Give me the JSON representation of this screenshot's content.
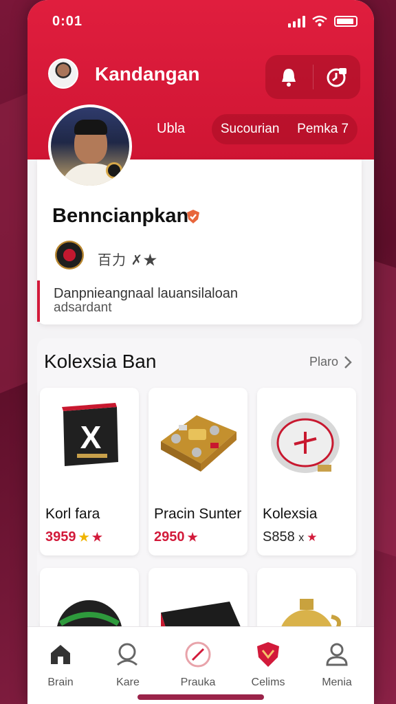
{
  "status": {
    "time": "0:01"
  },
  "header": {
    "app_title": "Kandangan",
    "tab_left": "Ubla",
    "tab_pill_a": "Sucourian",
    "tab_pill_b": "Pemka 7"
  },
  "profile": {
    "name": "Benncianpkan",
    "club_text": "百力 ✗★",
    "desc_line1": "Danpnieangnaal lauansilaloan",
    "desc_line2": "adsardant"
  },
  "collection": {
    "title": "Kolexsia Ban",
    "more_label": "Plaro",
    "items": [
      {
        "name": "Korl fara",
        "price": "3959",
        "stars": [
          "gold",
          "red"
        ]
      },
      {
        "name": "Pracin Sunter",
        "price": "2950",
        "stars": [
          "red"
        ]
      },
      {
        "name": "Kolexsia",
        "price": "S858",
        "extra": "x",
        "stars": [
          "red"
        ]
      }
    ]
  },
  "nav": {
    "items": [
      {
        "label": "Brain",
        "icon": "home-icon"
      },
      {
        "label": "Kare",
        "icon": "search-icon"
      },
      {
        "label": "Prauka",
        "icon": "slash-circle-icon"
      },
      {
        "label": "Celims",
        "icon": "shield-icon"
      },
      {
        "label": "Menia",
        "icon": "user-icon"
      }
    ]
  },
  "colors": {
    "accent": "#d21a3a",
    "header": "#e01e3e",
    "background": "#6e1533"
  }
}
